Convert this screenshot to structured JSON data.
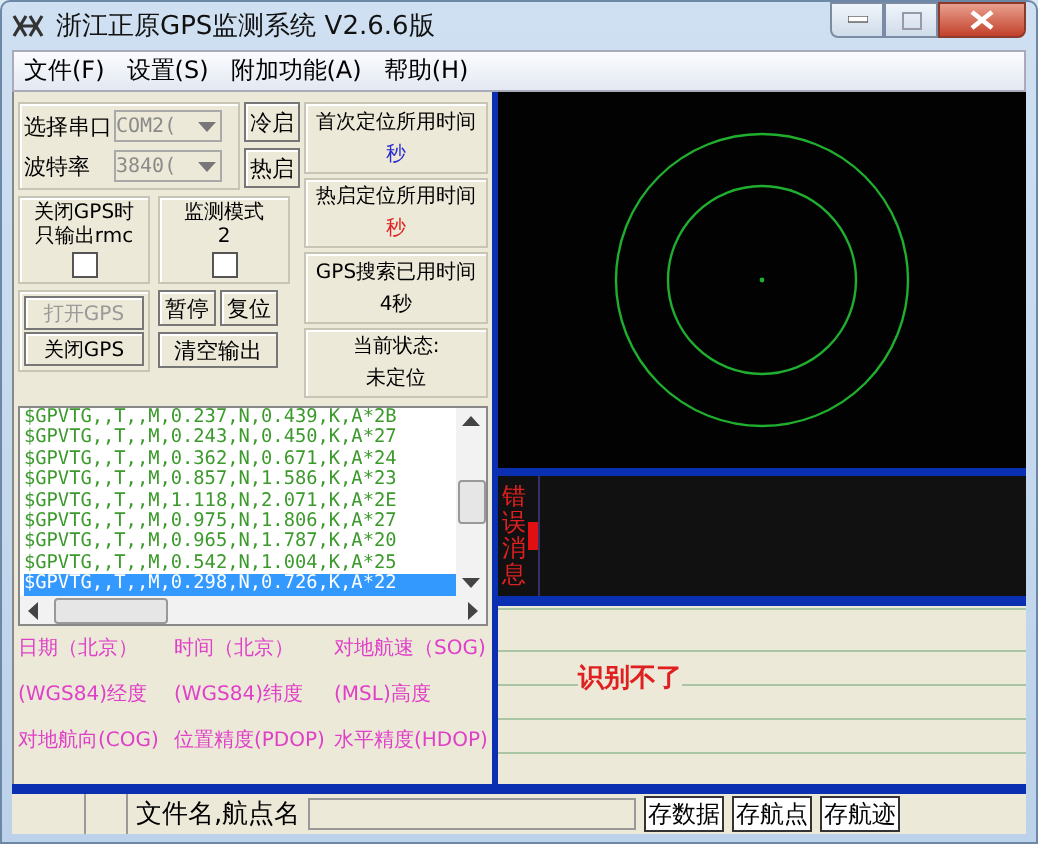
{
  "window": {
    "title": "浙江正原GPS监测系统 V2.6.6版"
  },
  "menu": [
    {
      "label": "文件(F)"
    },
    {
      "label": "设置(S)"
    },
    {
      "label": "附加功能(A)"
    },
    {
      "label": "帮助(H)"
    }
  ],
  "serial": [
    {
      "label": "选择串口",
      "value": "COM2(",
      "disabled": true
    },
    {
      "label": "波特率",
      "value": "3840(",
      "disabled": true
    }
  ],
  "start_buttons": [
    {
      "label": "冷启"
    },
    {
      "label": "热启"
    }
  ],
  "options": [
    {
      "label": "关闭GPS时只输出rmc",
      "checked": false
    },
    {
      "label": "监测模式",
      "value": "2",
      "checked": false
    }
  ],
  "gps_buttons": [
    {
      "label": "打开GPS",
      "disabled": true
    },
    {
      "label": "关闭GPS",
      "disabled": false
    }
  ],
  "control_buttons": [
    {
      "label": "暂停"
    },
    {
      "label": "复位"
    },
    {
      "label": "清空输出"
    }
  ],
  "info": [
    {
      "title": "首次定位所用时间",
      "value": "秒",
      "color": "#2a2ad0"
    },
    {
      "title": "热启定位所用时间",
      "value": "秒",
      "color": "#e02020"
    },
    {
      "title": "GPS搜索已用时间",
      "value": "4秒",
      "color": "#000000"
    },
    {
      "title": "当前状态:",
      "value": "未定位",
      "color": "#000000"
    }
  ],
  "log": [
    {
      "text": "$GPVTG,,T,,M,0.237,N,0.439,K,A*2B",
      "selected": false
    },
    {
      "text": "$GPVTG,,T,,M,0.243,N,0.450,K,A*27",
      "selected": false
    },
    {
      "text": "$GPVTG,,T,,M,0.362,N,0.671,K,A*24",
      "selected": false
    },
    {
      "text": "$GPVTG,,T,,M,0.857,N,1.586,K,A*23",
      "selected": false
    },
    {
      "text": "$GPVTG,,T,,M,1.118,N,2.071,K,A*2E",
      "selected": false
    },
    {
      "text": "$GPVTG,,T,,M,0.975,N,1.806,K,A*27",
      "selected": false
    },
    {
      "text": "$GPVTG,,T,,M,0.965,N,1.787,K,A*20",
      "selected": false
    },
    {
      "text": "$GPVTG,,T,,M,0.542,N,1.004,K,A*25",
      "selected": false
    },
    {
      "text": "$GPVTG,,T,,M,0.298,N,0.726,K,A*22",
      "selected": true
    }
  ],
  "fields": [
    "日期（北京）",
    "时间（北京）",
    "对地航速（SOG)",
    "(WGS84)经度",
    "(WGS84)纬度",
    "(MSL)高度",
    "对地航向(COG)",
    "位置精度(PDOP)",
    "水平精度(HDOP)"
  ],
  "error_label": "错误消息",
  "message": "识别不了",
  "bottom": {
    "label": "文件名,航点名",
    "buttons": [
      {
        "label": "存数据"
      },
      {
        "label": "存航点"
      },
      {
        "label": "存航迹"
      }
    ]
  }
}
